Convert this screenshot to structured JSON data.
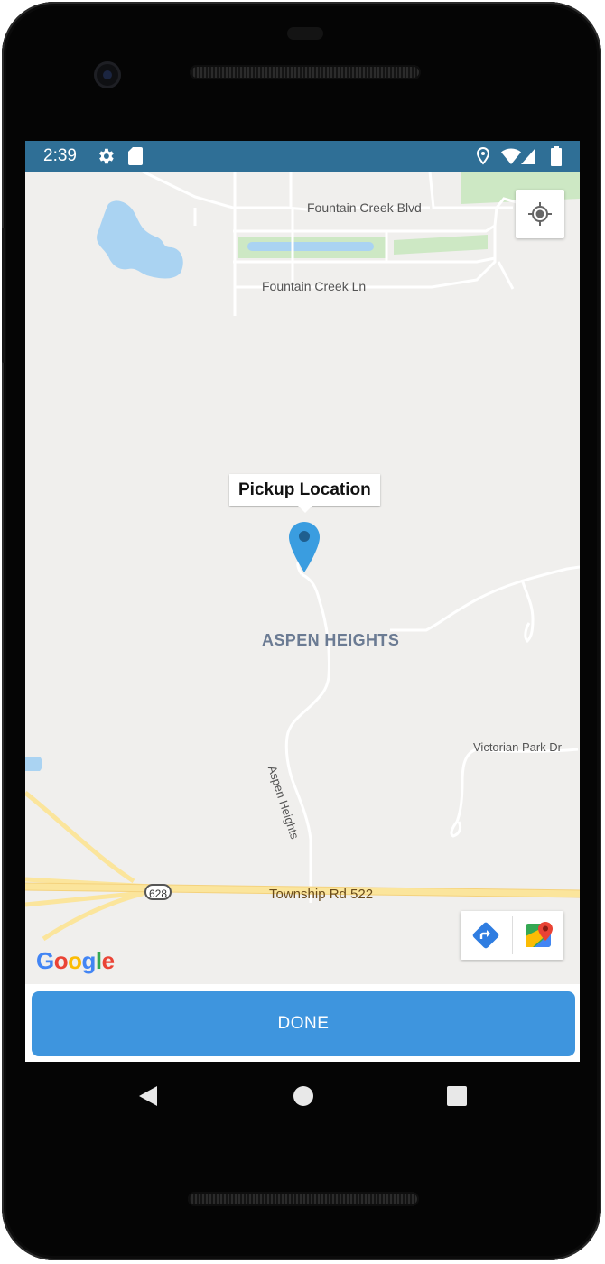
{
  "status_bar": {
    "time": "2:39",
    "icons": [
      "settings-icon",
      "sd-card-icon",
      "location-icon",
      "wifi-icon",
      "cell-signal-icon",
      "battery-icon"
    ],
    "background": "#2f6f96"
  },
  "map": {
    "labels": {
      "road_fountain_creek_blvd": "Fountain Creek Blvd",
      "road_fountain_creek_ln": "Fountain Creek Ln",
      "area_aspen_heights": "ASPEN HEIGHTS",
      "road_victorian_park": "Victorian Park Dr",
      "road_aspen_heights": "Aspen Heights",
      "road_township_rd": "Township Rd 522",
      "route_shield": "628"
    },
    "marker": {
      "title": "Pickup Location",
      "color": "#3a9de0"
    },
    "controls": {
      "my_location_icon": "my-location-icon",
      "directions_icon": "directions-icon",
      "google_maps_icon": "google-maps-icon"
    },
    "attribution": {
      "letters": [
        "G",
        "o",
        "o",
        "g",
        "l",
        "e"
      ],
      "colors": [
        "#4285F4",
        "#EA4335",
        "#FBBC05",
        "#4285F4",
        "#34A853",
        "#EA4335"
      ]
    }
  },
  "actions": {
    "done_label": "DONE",
    "done_color": "#3e95de"
  },
  "nav_bar": {
    "icons": [
      "back-icon",
      "home-icon",
      "recents-icon"
    ]
  }
}
